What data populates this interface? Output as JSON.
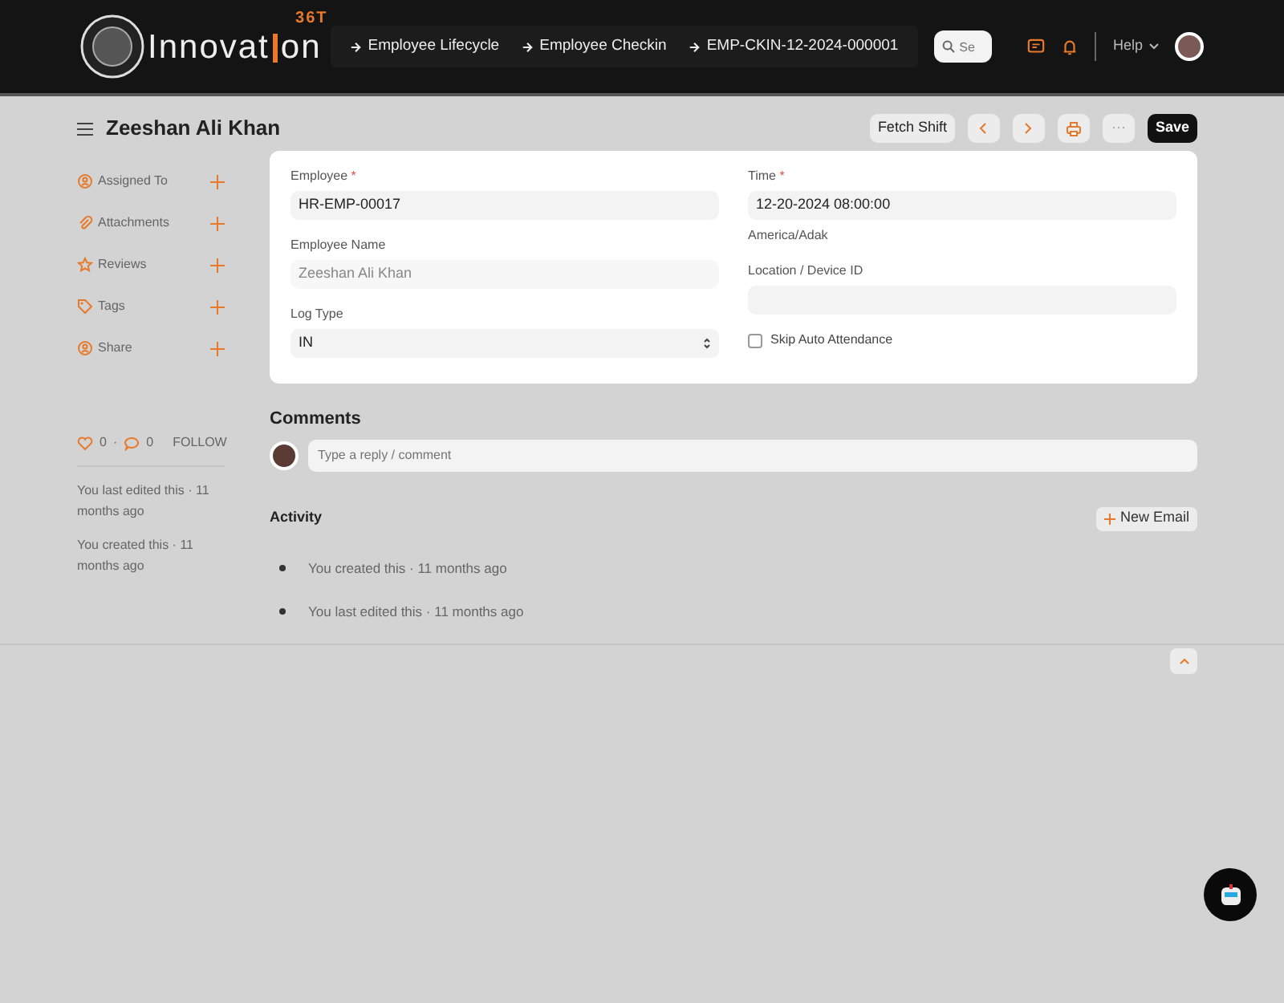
{
  "navbar": {
    "logo": {
      "before": "Innovat",
      "after": "on",
      "badge": "36T"
    },
    "breadcrumbs": [
      "Employee Lifecycle",
      "Employee Checkin",
      "EMP-CKIN-12-2024-000001"
    ],
    "search": {
      "placeholder": "Se"
    },
    "help": "Help"
  },
  "page": {
    "title": "Zeeshan Ali Khan",
    "actions": [
      {
        "kind": "text",
        "label": "Fetch Shift"
      },
      {
        "kind": "prev"
      },
      {
        "kind": "next"
      },
      {
        "kind": "print"
      },
      {
        "kind": "more",
        "label": "···"
      },
      {
        "kind": "primary",
        "label": "Save"
      }
    ]
  },
  "sidebar": {
    "items": [
      {
        "kind": "assign",
        "label": "Assigned To"
      },
      {
        "kind": "attach",
        "label": "Attachments"
      },
      {
        "kind": "review",
        "label": "Reviews"
      },
      {
        "kind": "tag",
        "label": "Tags"
      },
      {
        "kind": "share",
        "label": "Share"
      }
    ],
    "likes": "0",
    "separator": "·",
    "comments": "0",
    "follow": "FOLLOW",
    "meta": [
      "You last edited this · 11 months ago",
      "You created this · 11 months ago"
    ]
  },
  "form": {
    "required_mark": "*",
    "columns": [
      [
        {
          "kind": "input",
          "label": "Employee",
          "required": true,
          "readonly": false,
          "value": "HR-EMP-00017"
        },
        {
          "kind": "input",
          "label": "Employee Name",
          "required": false,
          "readonly": true,
          "value": "Zeeshan Ali Khan"
        },
        {
          "kind": "select",
          "label": "Log Type",
          "required": false,
          "readonly": false,
          "value": "IN"
        }
      ],
      [
        {
          "kind": "input",
          "label": "Time",
          "required": true,
          "readonly": false,
          "value": "12-20-2024 08:00:00",
          "description": "America/Adak"
        },
        {
          "kind": "input",
          "label": "Location / Device ID",
          "required": false
        },
        {
          "kind": "checkbox",
          "label": "Skip Auto Attendance",
          "checked": false
        }
      ]
    ]
  },
  "comments": {
    "title": "Comments",
    "placeholder": "Type a reply / comment"
  },
  "activity": {
    "title": "Activity",
    "new_email": "New Email",
    "items": [
      "You created this · 11 months ago",
      "You last edited this · 11 months ago"
    ]
  }
}
